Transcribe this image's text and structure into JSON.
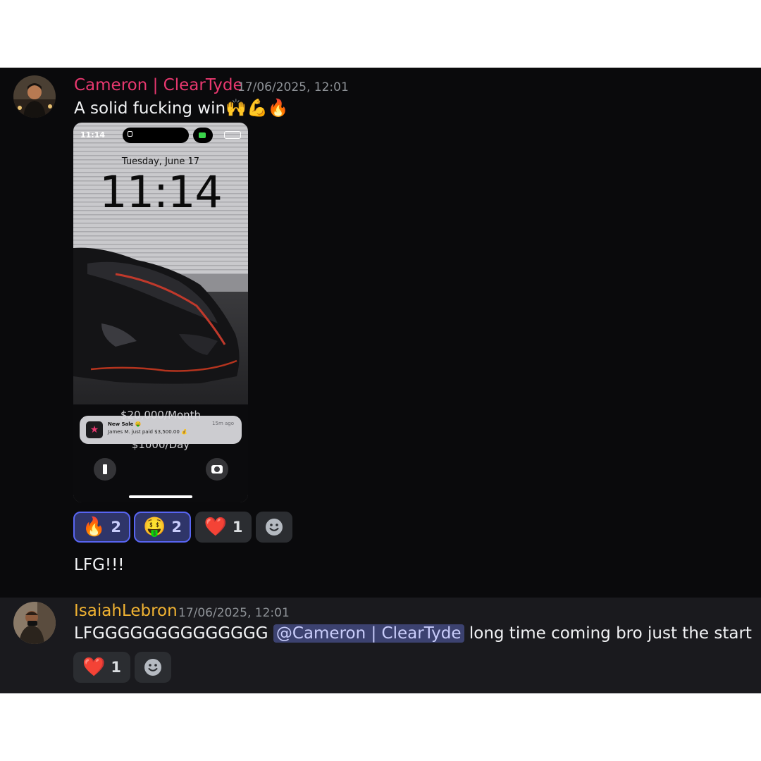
{
  "messages": [
    {
      "author": "Cameron | ClearTyde",
      "author_color": "#e8386f",
      "timestamp": "17/06/2025, 12:01",
      "text": "A solid fucking win",
      "emojis": "🙌💪🔥",
      "attachment": {
        "status_time": "11:14",
        "date": "Tuesday, June 17",
        "clock": "11:14",
        "notification": {
          "title": "New Sale",
          "title_emoji": "🤑",
          "body": "James M. just paid $3,500.00",
          "body_emoji": "💰",
          "age": "15m ago"
        },
        "under_text_1": "$20,000/Month",
        "under_text_2": "$1000/Day"
      },
      "reactions": [
        {
          "emoji": "🔥",
          "count": "2",
          "active": true
        },
        {
          "emoji": "🤑",
          "count": "2",
          "active": true
        },
        {
          "emoji": "❤️",
          "count": "1",
          "active": false
        }
      ],
      "followup": "LFG!!!"
    },
    {
      "author": "IsaiahLebron",
      "author_color": "#f0b232",
      "timestamp": "17/06/2025, 12:01",
      "text_before": "LFGGGGGGGGGGGGGG",
      "mention": "@Cameron | ClearTyde",
      "text_after": "long time coming bro just the start",
      "reactions": [
        {
          "emoji": "❤️",
          "count": "1",
          "active": false
        }
      ]
    }
  ],
  "icons": {
    "add_reaction": "smiley-face-icon",
    "flashlight": "flashlight-icon",
    "camera": "camera-icon",
    "lock": "lock-icon",
    "facetime": "video-camera-icon"
  }
}
